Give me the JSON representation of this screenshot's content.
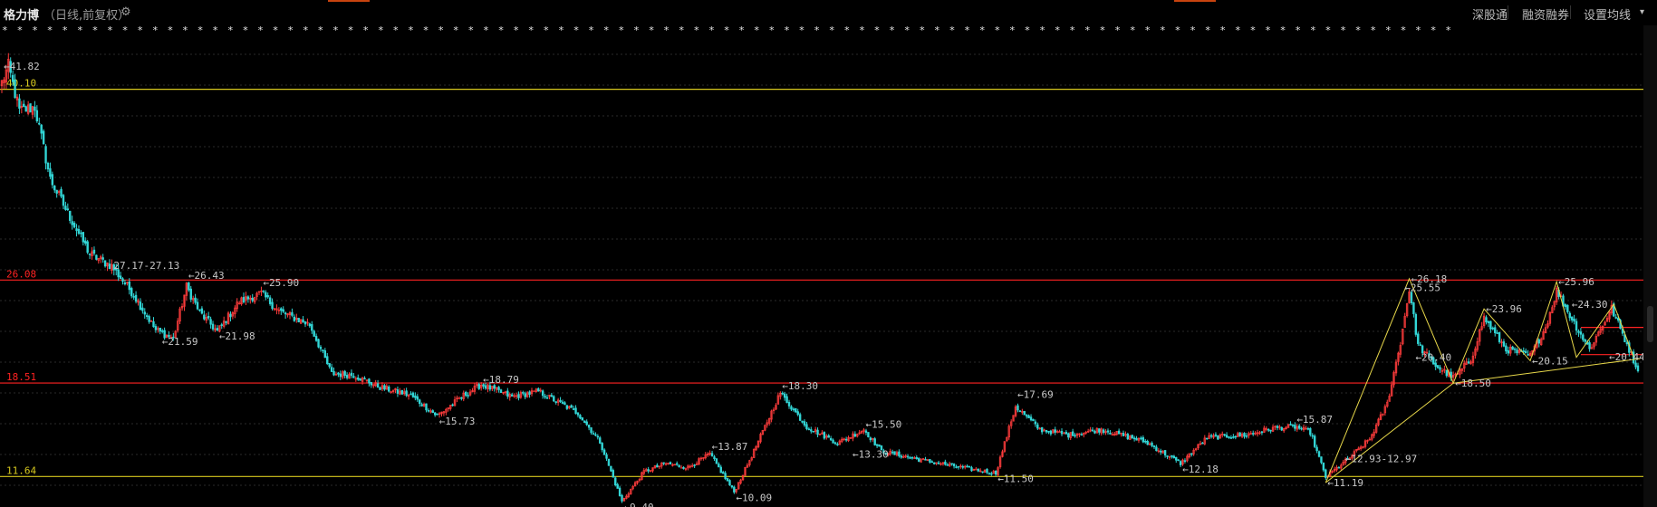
{
  "header": {
    "stock_name": "格力博",
    "mode_label": "（日线,前复权）",
    "settings_icon": "gear-icon",
    "buttons": [
      "深股通",
      "融资融券",
      "设置均线"
    ]
  },
  "colors": {
    "background": "#000000",
    "up_candle": "#ff3c3c",
    "down_candle": "#32d6d6",
    "support_line_red": "#ff2222",
    "level_line_yellow": "#d6c81e",
    "pattern_line": "#e8d84a",
    "grid": "#2a2a2a",
    "label_text": "#c8c8c8"
  },
  "chart_data": {
    "type": "candlestick",
    "ylim": [
      9.4,
      44.0
    ],
    "grid": true,
    "horizontal_levels": [
      {
        "label": "40.10",
        "value": 40.1,
        "color": "#d6c81e"
      },
      {
        "label": "26.08",
        "value": 26.08,
        "color": "#ff2222"
      },
      {
        "label": "18.51",
        "value": 18.51,
        "color": "#ff2222"
      },
      {
        "label": "11.64",
        "value": 11.64,
        "color": "#d6c81e"
      }
    ],
    "annotations": [
      {
        "text": "←41.82",
        "index": 0,
        "value": 41.82
      },
      {
        "text": "27.17-27.13",
        "index": 50,
        "value": 27.17
      },
      {
        "text": "←26.43",
        "index": 84,
        "value": 26.43
      },
      {
        "text": "←25.90",
        "index": 118,
        "value": 25.9
      },
      {
        "text": "←21.59",
        "index": 72,
        "value": 21.59
      },
      {
        "text": "←21.98",
        "index": 98,
        "value": 21.98
      },
      {
        "text": "←18.79",
        "index": 218,
        "value": 18.79
      },
      {
        "text": "←15.73",
        "index": 198,
        "value": 15.73
      },
      {
        "text": "←18.30",
        "index": 354,
        "value": 18.3
      },
      {
        "text": "←13.87",
        "index": 322,
        "value": 13.87
      },
      {
        "text": "←15.50",
        "index": 392,
        "value": 15.5
      },
      {
        "text": "←13.30",
        "index": 386,
        "value": 13.3
      },
      {
        "text": "←9.40",
        "index": 282,
        "value": 9.4
      },
      {
        "text": "←10.09",
        "index": 333,
        "value": 10.09
      },
      {
        "text": "←17.69",
        "index": 461,
        "value": 17.69
      },
      {
        "text": "←11.50",
        "index": 452,
        "value": 11.5
      },
      {
        "text": "←12.18",
        "index": 536,
        "value": 12.18
      },
      {
        "text": "←15.87",
        "index": 588,
        "value": 15.87
      },
      {
        "text": "←11.19",
        "index": 602,
        "value": 11.19
      },
      {
        "text": "←12.93-12.97",
        "index": 610,
        "value": 12.95
      },
      {
        "text": "←26.18",
        "index": 640,
        "value": 26.18
      },
      {
        "text": "←25.55",
        "index": 637,
        "value": 25.55
      },
      {
        "text": "←20.40",
        "index": 642,
        "value": 20.4
      },
      {
        "text": "←18.50",
        "index": 660,
        "value": 18.5
      },
      {
        "text": "←23.96",
        "index": 674,
        "value": 23.96
      },
      {
        "text": "←20.15",
        "index": 695,
        "value": 20.15
      },
      {
        "text": "←25.96",
        "index": 707,
        "value": 25.96
      },
      {
        "text": "←24.30",
        "index": 713,
        "value": 24.3
      },
      {
        "text": "←20.44",
        "index": 730,
        "value": 20.44
      }
    ],
    "pattern_points": [
      {
        "index": 602,
        "value": 11.19
      },
      {
        "index": 640,
        "value": 26.18
      },
      {
        "index": 660,
        "value": 18.5
      },
      {
        "index": 674,
        "value": 23.96
      },
      {
        "index": 695,
        "value": 20.15
      },
      {
        "index": 707,
        "value": 25.96
      },
      {
        "index": 716,
        "value": 20.4
      },
      {
        "index": 733,
        "value": 24.3
      },
      {
        "index": 742,
        "value": 20.44
      }
    ],
    "trend_line": [
      {
        "index": 660,
        "value": 18.5
      },
      {
        "index": 745,
        "value": 20.3
      }
    ],
    "right_levels": [
      {
        "value": 22.6,
        "color": "#ff2222"
      },
      {
        "value": 20.6,
        "color": "#ff2222"
      }
    ],
    "n_candles": 745,
    "anchors": [
      [
        0,
        40.6
      ],
      [
        3,
        41.8
      ],
      [
        8,
        38.5
      ],
      [
        15,
        38.8
      ],
      [
        22,
        33.5
      ],
      [
        30,
        31.0
      ],
      [
        40,
        28.0
      ],
      [
        50,
        27.1
      ],
      [
        60,
        25.0
      ],
      [
        70,
        22.4
      ],
      [
        78,
        21.8
      ],
      [
        84,
        25.6
      ],
      [
        90,
        23.7
      ],
      [
        98,
        22.3
      ],
      [
        108,
        24.5
      ],
      [
        118,
        25.1
      ],
      [
        126,
        23.8
      ],
      [
        140,
        22.8
      ],
      [
        150,
        19.2
      ],
      [
        160,
        19.1
      ],
      [
        172,
        18.2
      ],
      [
        186,
        17.6
      ],
      [
        198,
        16.1
      ],
      [
        210,
        17.6
      ],
      [
        218,
        18.4
      ],
      [
        232,
        17.5
      ],
      [
        244,
        17.9
      ],
      [
        252,
        17.2
      ],
      [
        262,
        16.3
      ],
      [
        272,
        14.2
      ],
      [
        282,
        9.8
      ],
      [
        292,
        12.0
      ],
      [
        302,
        12.6
      ],
      [
        312,
        12.3
      ],
      [
        322,
        13.3
      ],
      [
        333,
        10.5
      ],
      [
        342,
        13.5
      ],
      [
        354,
        17.8
      ],
      [
        366,
        15.3
      ],
      [
        380,
        14.1
      ],
      [
        392,
        15.1
      ],
      [
        400,
        13.5
      ],
      [
        420,
        12.8
      ],
      [
        440,
        12.2
      ],
      [
        452,
        11.9
      ],
      [
        461,
        16.8
      ],
      [
        472,
        15.1
      ],
      [
        485,
        14.7
      ],
      [
        500,
        15.1
      ],
      [
        520,
        14.2
      ],
      [
        536,
        12.6
      ],
      [
        548,
        14.5
      ],
      [
        566,
        14.7
      ],
      [
        578,
        15.2
      ],
      [
        588,
        15.3
      ],
      [
        595,
        14.9
      ],
      [
        602,
        11.6
      ],
      [
        612,
        12.9
      ],
      [
        622,
        14.4
      ],
      [
        630,
        17.0
      ],
      [
        636,
        21.5
      ],
      [
        640,
        25.4
      ],
      [
        644,
        21.3
      ],
      [
        652,
        19.8
      ],
      [
        660,
        18.9
      ],
      [
        668,
        20.2
      ],
      [
        674,
        23.3
      ],
      [
        684,
        21.0
      ],
      [
        695,
        20.5
      ],
      [
        702,
        22.6
      ],
      [
        707,
        25.3
      ],
      [
        714,
        23.2
      ],
      [
        722,
        21.0
      ],
      [
        732,
        24.0
      ],
      [
        740,
        21.0
      ],
      [
        744,
        19.4
      ]
    ]
  },
  "signal_row": {
    "marks": "** *** *** * ** * * *** * ** * * ** *** * * * * ** * ** ** * ***** ** ** ** * *** ** * ** *** * * * * ** * * * ** ** * * ***** *** * ** * ** *** ** **"
  }
}
